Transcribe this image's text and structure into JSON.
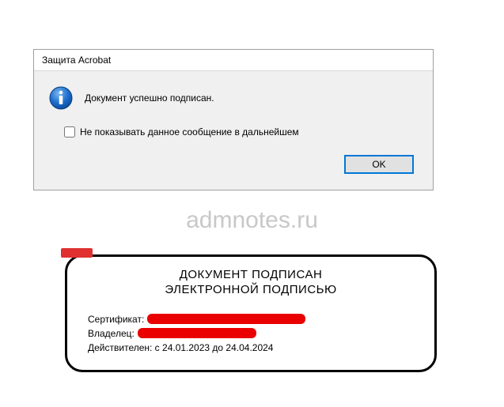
{
  "dialog": {
    "title": "Защита Acrobat",
    "message": "Документ успешно подписан.",
    "checkbox_label": "Не показывать данное сообщение в дальнейшем",
    "ok_label": "OK"
  },
  "watermark": "admnotes.ru",
  "signature": {
    "heading_line1": "ДОКУМЕНТ ПОДПИСАН",
    "heading_line2": "ЭЛЕКТРОННОЙ ПОДПИСЬЮ",
    "cert_label": "Сертификат:",
    "owner_label": "Владелец:",
    "validity": "Действителен: с 24.01.2023 до 24.04.2024"
  }
}
